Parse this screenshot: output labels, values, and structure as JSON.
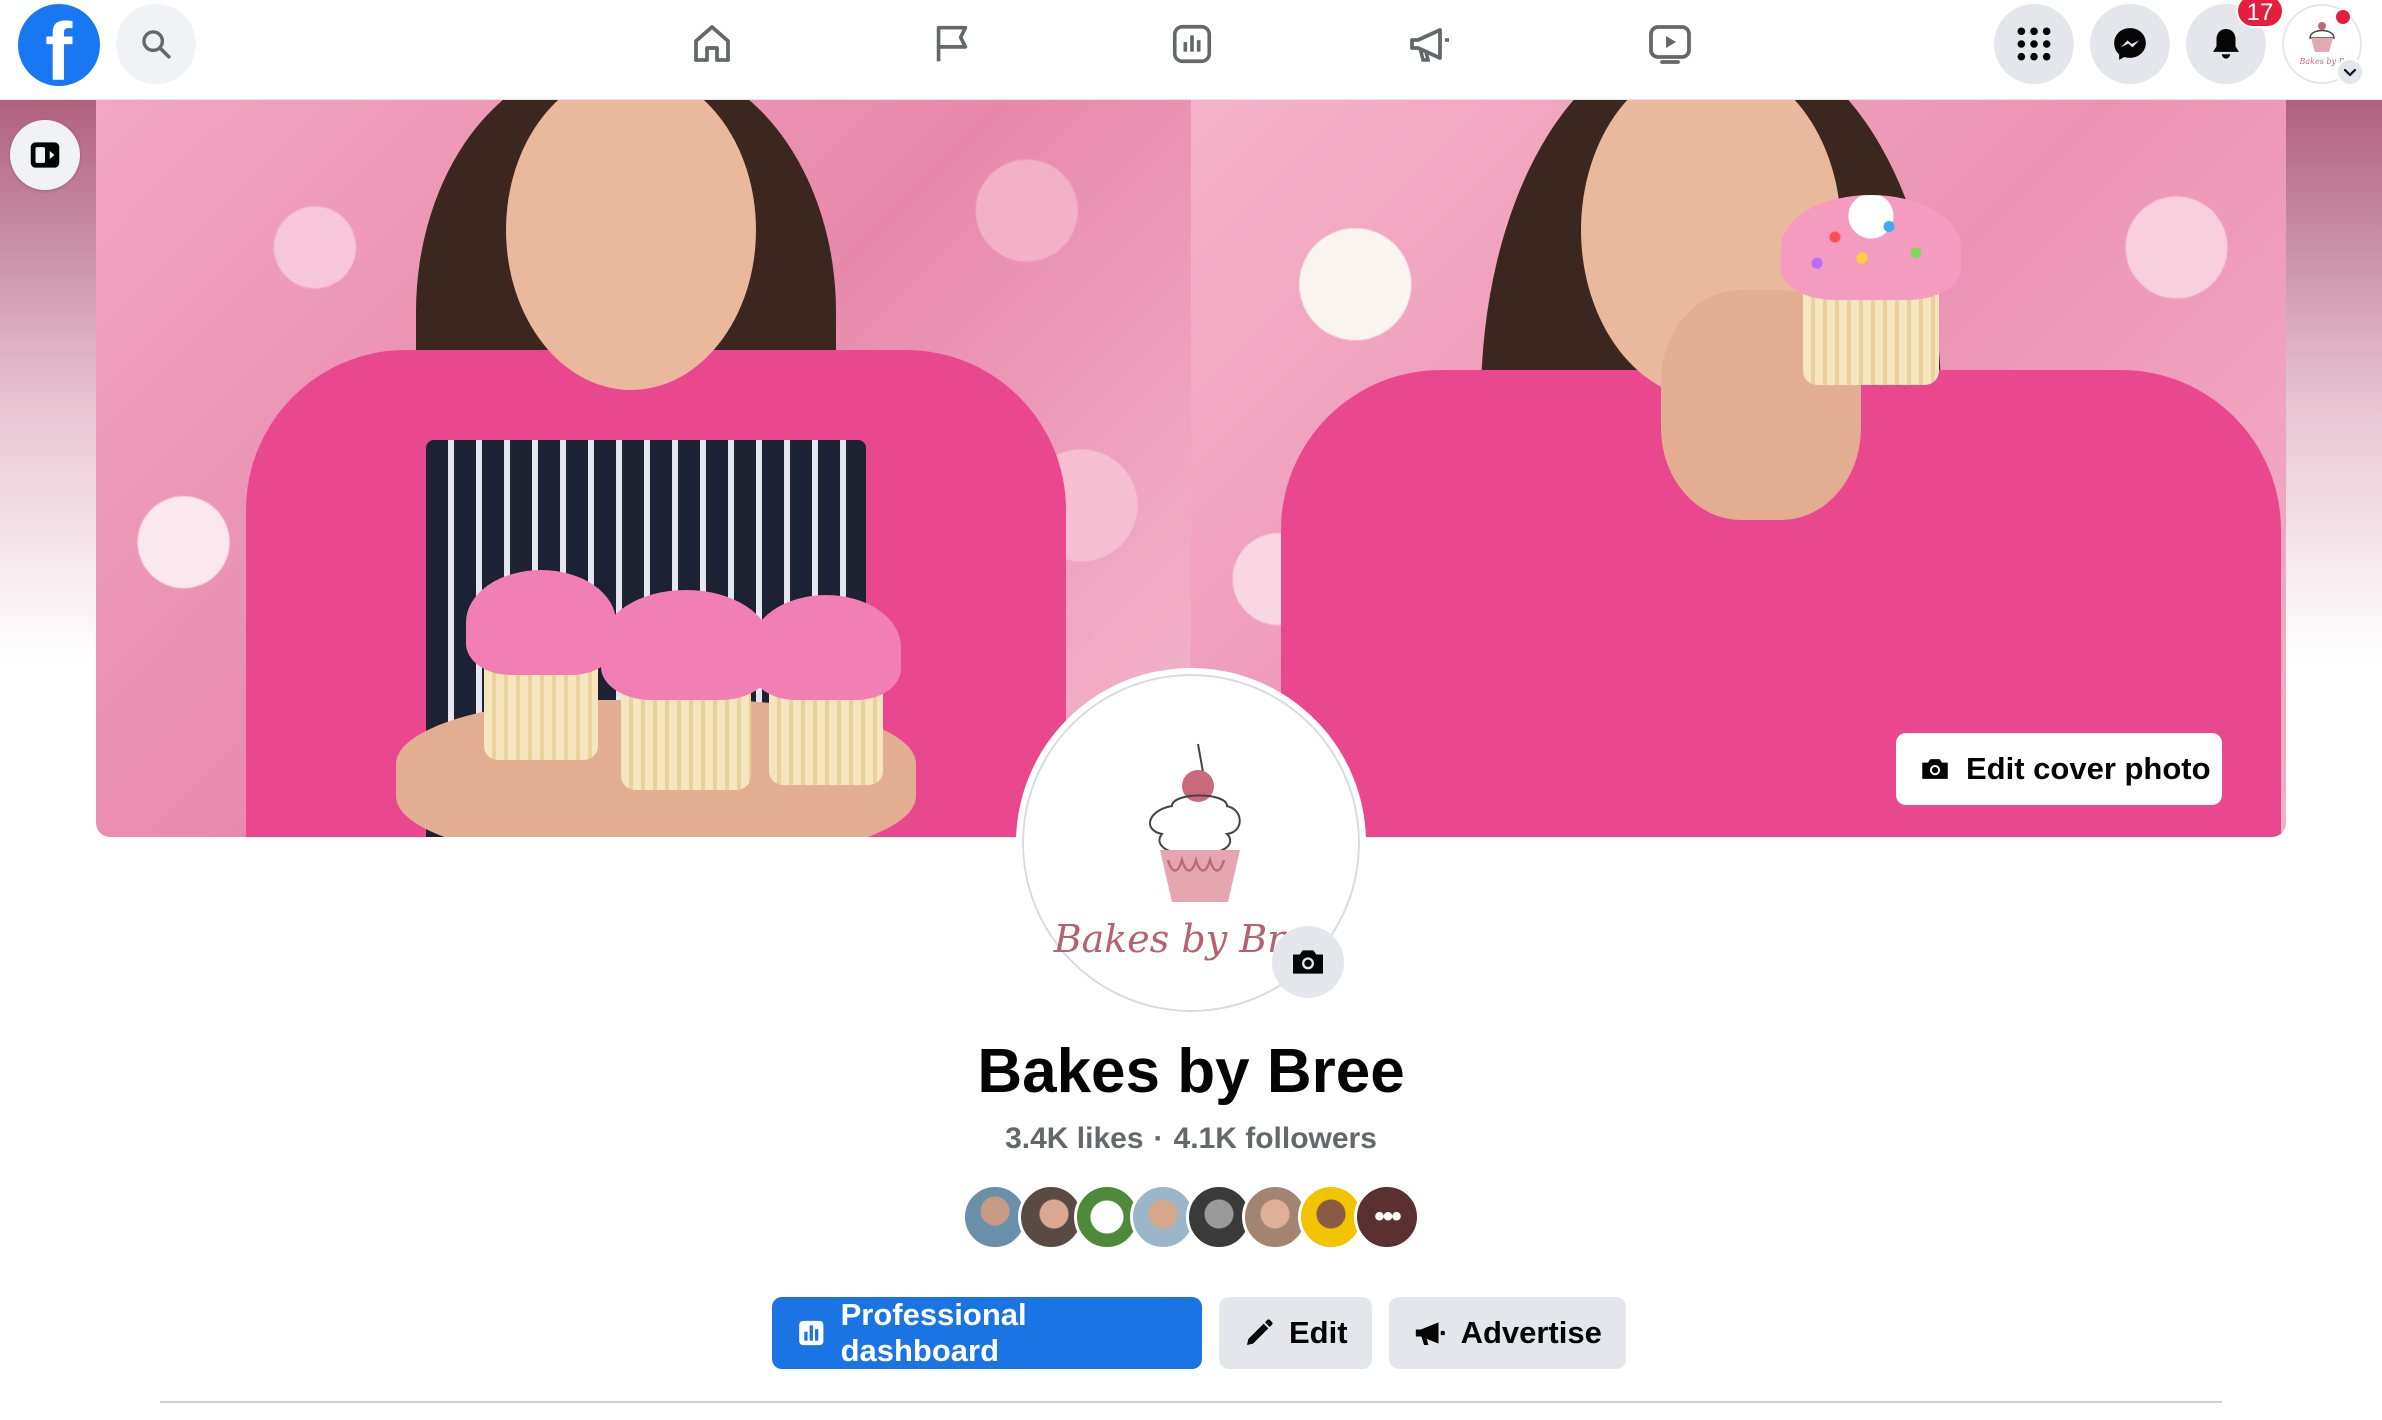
{
  "topbar": {
    "nav": [
      {
        "name": "home",
        "icon": "home-icon"
      },
      {
        "name": "pages",
        "icon": "flag-icon"
      },
      {
        "name": "insights",
        "icon": "bar-chart-icon"
      },
      {
        "name": "ad-center",
        "icon": "megaphone-icon"
      },
      {
        "name": "watch",
        "icon": "video-play-icon"
      }
    ],
    "notifications_count": "17"
  },
  "cover": {
    "edit_label": "Edit cover photo"
  },
  "profile": {
    "logo_text": "Bakes by Bree",
    "name": "Bakes by Bree",
    "likes": "3.4K likes",
    "separator": "·",
    "followers": "4.1K followers",
    "friend_avatars_count": 8
  },
  "actions": {
    "professional_dashboard": "Professional dashboard",
    "edit": "Edit",
    "advertise": "Advertise"
  },
  "colors": {
    "brand": "#1877f2",
    "primary_button": "#1b74e4",
    "badge": "#e41e3f",
    "logo_pink": "#c06a7a"
  }
}
